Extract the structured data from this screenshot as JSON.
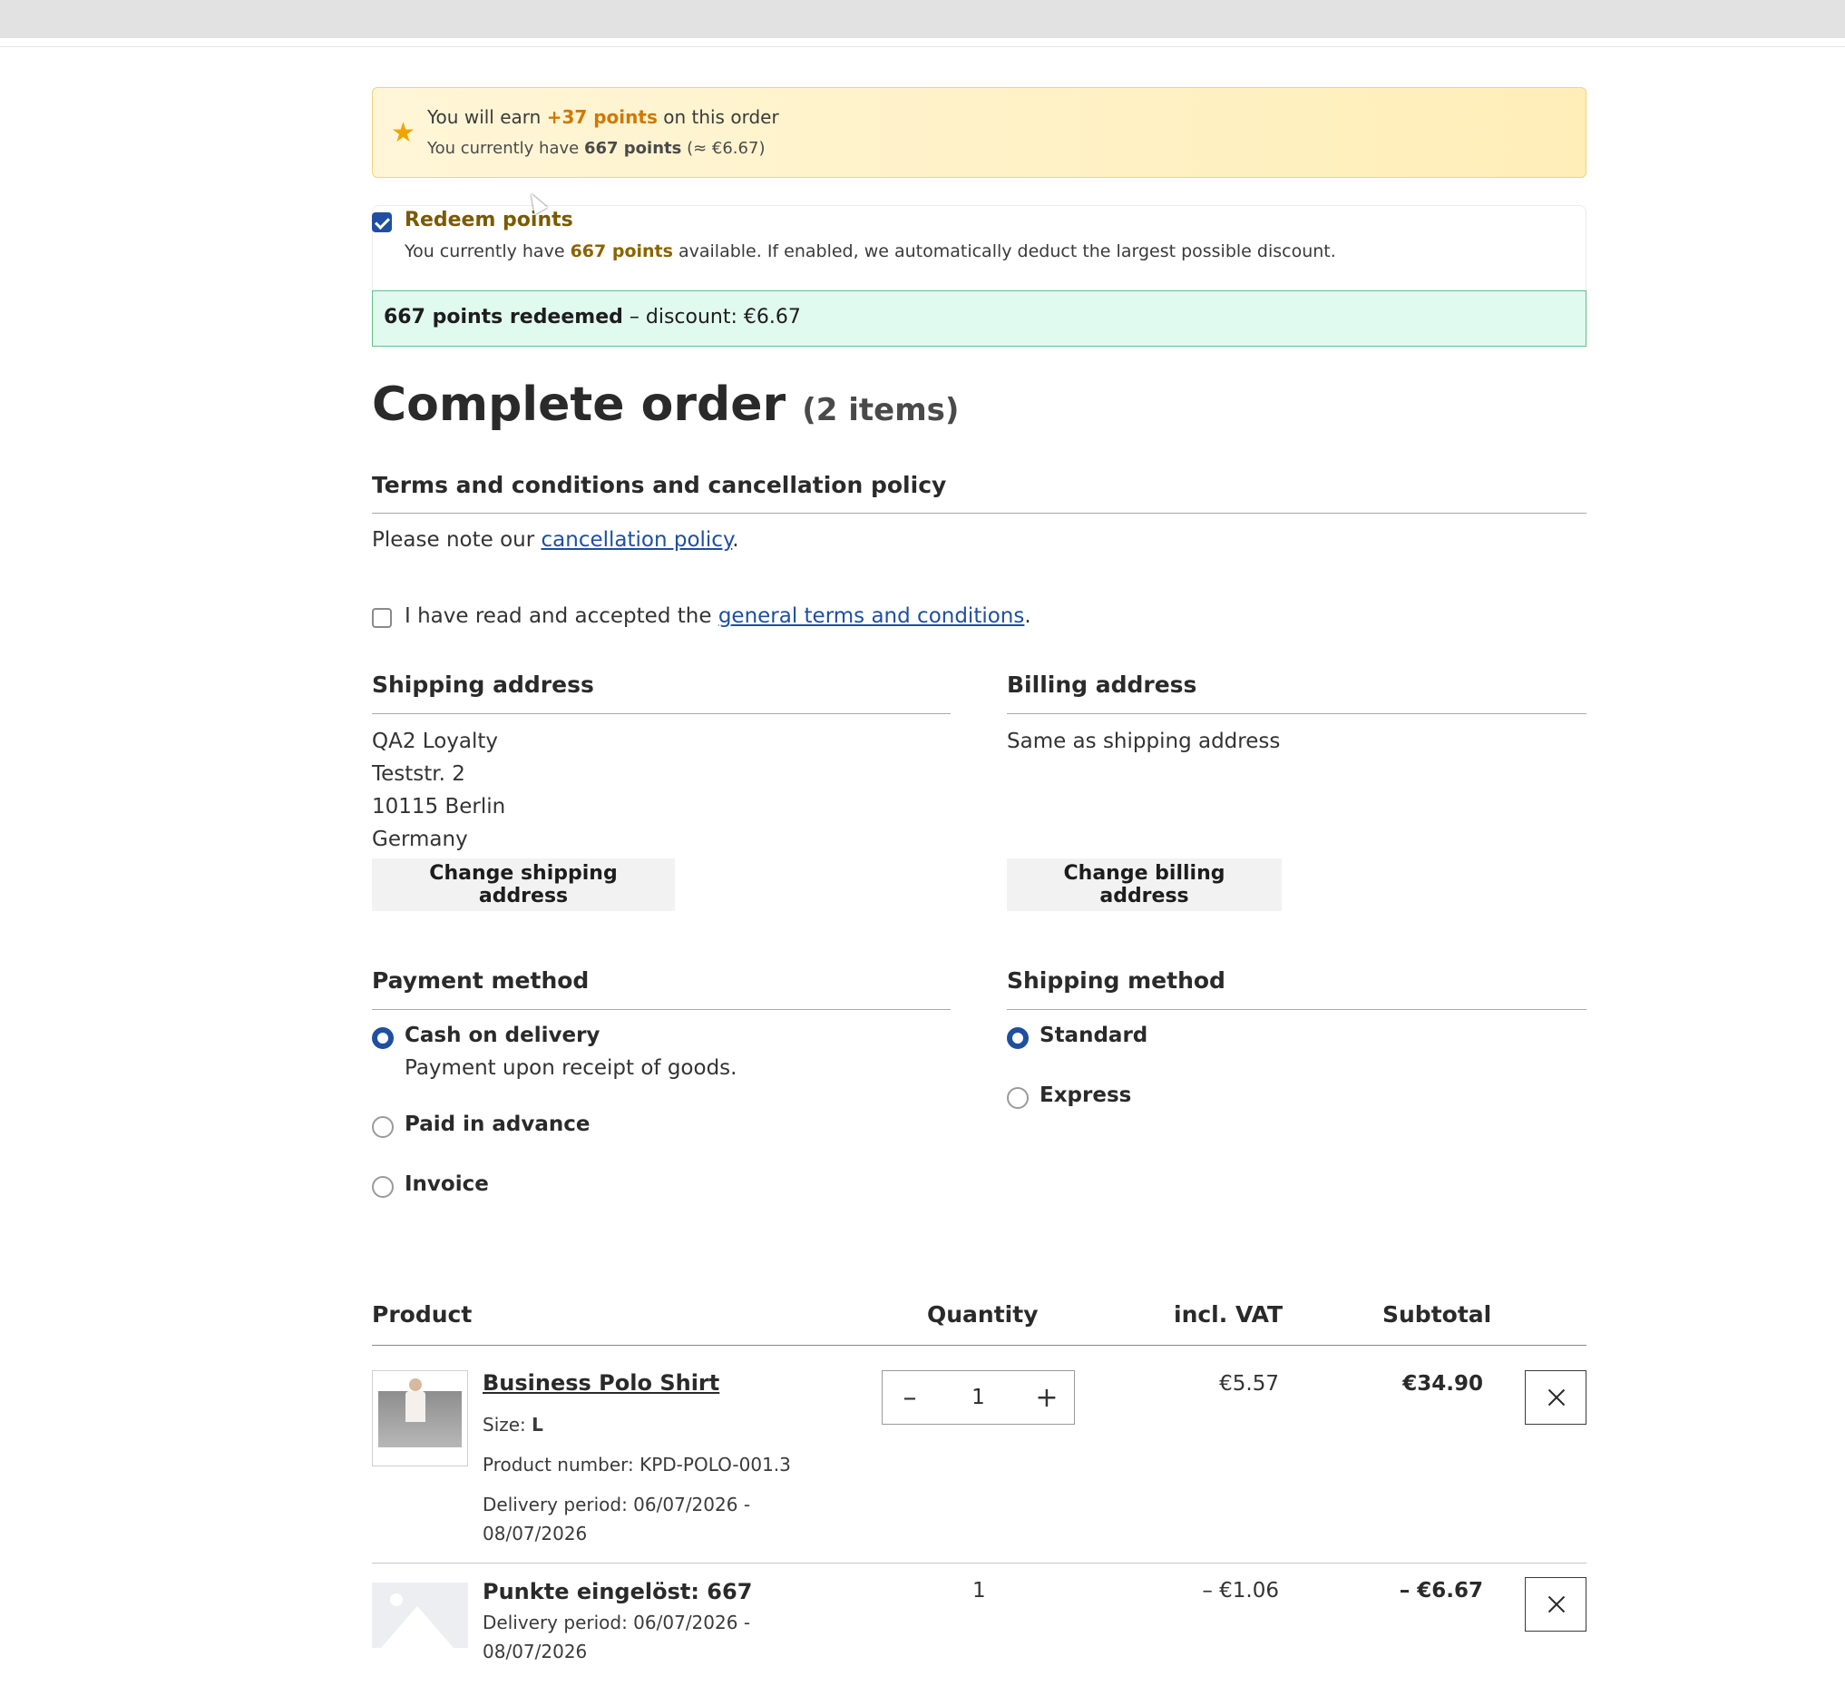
{
  "loyalty": {
    "earn_prefix": "You will earn ",
    "earn_points": "+37 points",
    "earn_suffix": " on this order",
    "have_prefix": "You currently have ",
    "have_points": "667 points",
    "have_suffix": " (≈ €6.67)"
  },
  "redeem": {
    "title": "Redeem points",
    "desc_prefix": "You currently have ",
    "desc_points": "667 points",
    "desc_suffix": " available. If enabled, we automatically deduct the largest possible discount.",
    "checked": true,
    "redeemed_bold": "667 points redeemed",
    "redeemed_rest": " – discount: €6.67"
  },
  "page": {
    "title": "Complete order",
    "count": "(2 items)"
  },
  "terms": {
    "heading": "Terms and conditions and cancellation policy",
    "note_prefix": "Please note our ",
    "note_link": "cancellation policy",
    "note_suffix": ".",
    "accept_prefix": "I have read and accepted the ",
    "accept_link": "general terms and conditions",
    "accept_suffix": "."
  },
  "shipping_address": {
    "heading": "Shipping address",
    "lines": [
      "QA2 Loyalty",
      "Teststr. 2",
      "10115 Berlin",
      "Germany"
    ],
    "button": "Change shipping address"
  },
  "billing_address": {
    "heading": "Billing address",
    "text": "Same as shipping address",
    "button": "Change billing address"
  },
  "payment": {
    "heading": "Payment method",
    "options": [
      {
        "label": "Cash on delivery",
        "desc": "Payment upon receipt of goods.",
        "selected": true
      },
      {
        "label": "Paid in advance",
        "selected": false
      },
      {
        "label": "Invoice",
        "selected": false
      }
    ]
  },
  "shipping_method": {
    "heading": "Shipping method",
    "options": [
      {
        "label": "Standard",
        "selected": true
      },
      {
        "label": "Express",
        "selected": false
      }
    ]
  },
  "table": {
    "headers": {
      "product": "Product",
      "quantity": "Quantity",
      "vat": "incl. VAT",
      "subtotal": "Subtotal"
    },
    "rows": [
      {
        "name": "Business Polo Shirt",
        "size_label": "Size: ",
        "size_value": "L",
        "product_number": "Product number: KPD-POLO-001.3",
        "delivery_1": "Delivery period: 06/07/2026 -",
        "delivery_2": "08/07/2026",
        "quantity": "1",
        "vat": "€5.57",
        "subtotal": "€34.90"
      },
      {
        "name": "Punkte eingelöst: 667",
        "delivery_1": "Delivery period: 06/07/2026 -",
        "delivery_2": "08/07/2026",
        "quantity": "1",
        "vat": "– €1.06",
        "subtotal": "– €6.67"
      }
    ]
  },
  "icons": {
    "star": "star-icon",
    "minus": "minus-icon",
    "plus": "plus-icon",
    "close": "close-icon"
  },
  "colors": {
    "accent": "#1f4fa0",
    "points_orange": "#d07800",
    "success_bg": "#e0faf0",
    "success_border": "#5fc08a"
  },
  "glyphs": {
    "star": "★",
    "minus": "–",
    "plus": "+"
  }
}
